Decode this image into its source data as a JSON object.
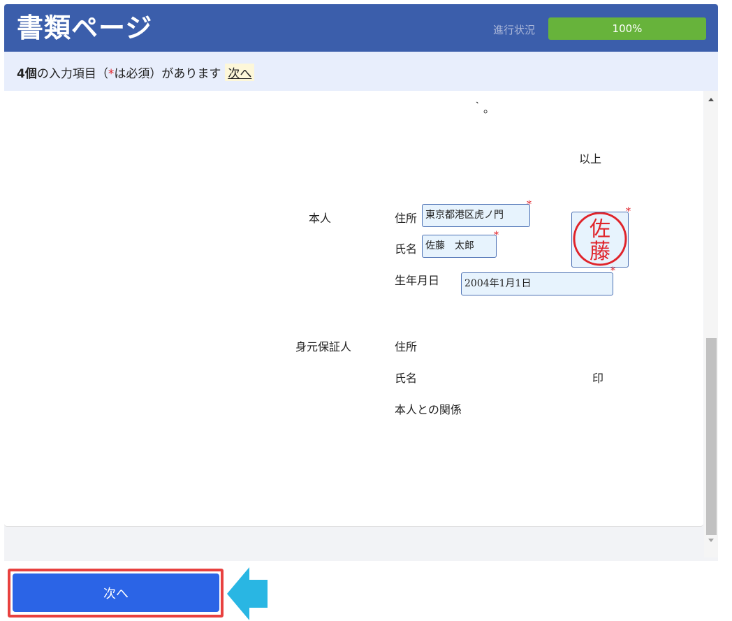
{
  "header": {
    "title": "書類ページ",
    "progress_label": "進行状況",
    "progress_text": "100%",
    "progress_value": 100
  },
  "infobar": {
    "count": "4個",
    "text_before_star": "の入力項目（",
    "star": "*",
    "text_after_star": "は必須）があります",
    "next_link": "次へ"
  },
  "document": {
    "fragment_top": "｀。",
    "ijo": "以上",
    "honnin_label": "本人",
    "address_label": "住所",
    "name_label": "氏名",
    "birth_label": "生年月日",
    "guarantor_label": "身元保証人",
    "guarantor_address_label": "住所",
    "guarantor_name_label": "氏名",
    "seal_label": "印",
    "relation_label": "本人との関係",
    "required_mark": "*"
  },
  "fields": {
    "address_value": "東京都港区虎ノ門",
    "name_value": "佐藤　太郎",
    "birth_value": "2004年1月1日"
  },
  "seal": {
    "top_char": "佐",
    "bottom_char": "藤",
    "color": "#e0242b"
  },
  "footer": {
    "next_button": "次へ"
  },
  "colors": {
    "header_bg": "#3b5eab",
    "progress_fill": "#67b33b",
    "button_bg": "#2b64e6",
    "highlight_border": "#e8413f",
    "arrow": "#29b6e3"
  }
}
